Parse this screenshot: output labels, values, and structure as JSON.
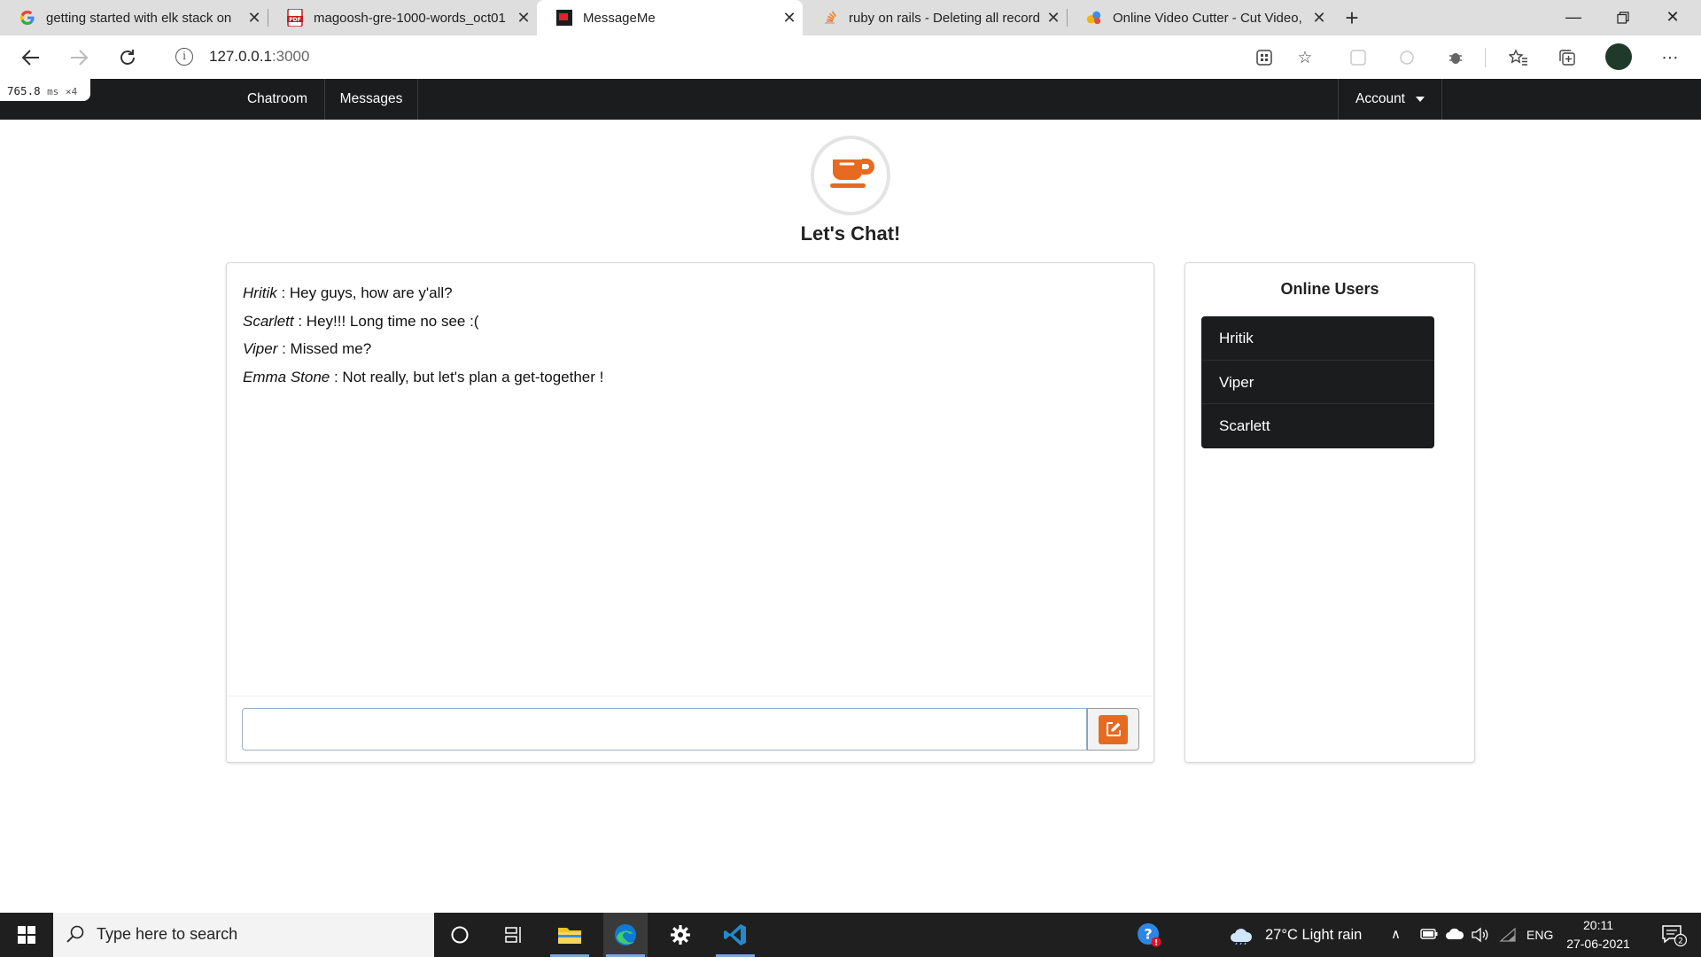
{
  "browser": {
    "tabs": [
      {
        "title": "getting started with elk stack on",
        "icon": "google-g-icon"
      },
      {
        "title": "magoosh-gre-1000-words_oct01",
        "icon": "pdf-icon"
      },
      {
        "title": "MessageMe",
        "icon": "app-favicon",
        "active": true
      },
      {
        "title": "ruby on rails - Deleting all record",
        "icon": "stackoverflow-icon"
      },
      {
        "title": "Online Video Cutter - Cut Video,",
        "icon": "video-cutter-icon"
      }
    ],
    "url_host": "127.0.0.1",
    "url_port": ":3000"
  },
  "perf": {
    "value": "765.8",
    "unit": "ms",
    "multiplier": "×4"
  },
  "navbar": {
    "links": [
      "Chatroom",
      "Messages"
    ],
    "account_label": "Account"
  },
  "page": {
    "heading": "Let's Chat!",
    "messages": [
      {
        "user": "Hritik",
        "text": " : Hey guys, how are y'all?"
      },
      {
        "user": "Scarlett",
        "text": " : Hey!!! Long time no see :("
      },
      {
        "user": "Viper",
        "text": " : Missed me?"
      },
      {
        "user": "Emma Stone",
        "text": " : Not really, but let's plan a get-together !"
      }
    ],
    "message_input_value": "",
    "online_users_title": "Online Users",
    "online_users": [
      "Hritik",
      "Viper",
      "Scarlett"
    ]
  },
  "taskbar": {
    "search_placeholder": "Type here to search",
    "weather": "27°C  Light rain",
    "language": "ENG",
    "time": "20:11",
    "date": "27-06-2021",
    "notification_count": "2"
  },
  "colors": {
    "accent": "#e66a1f",
    "navbar": "#1b1c1d",
    "user_list": "#1b1c1d"
  }
}
